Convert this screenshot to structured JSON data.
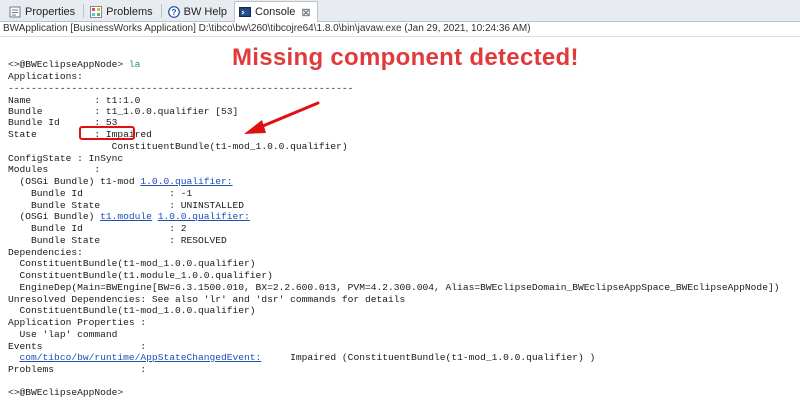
{
  "tabs": [
    {
      "label": "Properties",
      "icon": "properties-icon",
      "active": false
    },
    {
      "label": "Problems",
      "icon": "problems-icon",
      "active": false
    },
    {
      "label": "BW Help",
      "icon": "help-icon",
      "active": false
    },
    {
      "label": "Console",
      "icon": "console-icon",
      "active": true,
      "close": "⊠"
    }
  ],
  "launch_title": "BWApplication [BusinessWorks Application] D:\\tibco\\bw\\260\\tibcojre64\\1.8.0\\bin\\javaw.exe (Jan 29, 2021, 10:24:36 AM)",
  "annotation": {
    "text": "Missing component detected!",
    "color": "#e03a3a"
  },
  "console": {
    "prompt1": "<>@BWEclipseAppNode>",
    "command": "la",
    "applications": "Applications:",
    "separator": "------------------------------------------------------------",
    "name": "Name           : t1:1.0",
    "bundle": "Bundle         : t1_1.0.0.qualifier [53]",
    "bundle_id": "Bundle Id      : 53",
    "state_label": "State          : ",
    "state_value": "Impaired",
    "constituent": "                  ConstituentBundle(t1-mod_1.0.0.qualifier)",
    "configstate": "ConfigState : InSync",
    "modules": "Modules        :",
    "osgi1_prefix": "  (OSGi Bundle) t1-mod ",
    "osgi1_link": "1.0.0.qualifier:",
    "osgi1_bid_label": "    Bundle Id               ",
    "osgi1_bid_value": ": -1",
    "osgi1_bstate": "    Bundle State            : UNINSTALLED",
    "osgi2_prefix": "  (OSGi Bundle) ",
    "osgi2_link1": "t1.module",
    "osgi2_space": " ",
    "osgi2_link2": "1.0.0.qualifier:",
    "osgi2_bid": "    Bundle Id               : 2",
    "osgi2_bstate": "    Bundle State            : RESOLVED",
    "dependencies": "Dependencies:",
    "dep1": "  ConstituentBundle(t1-mod_1.0.0.qualifier)",
    "dep2": "  ConstituentBundle(t1.module_1.0.0.qualifier)",
    "dep3": "  EngineDep(Main=BWEngine[BW=6.3.1500.010, BX=2.2.600.013, PVM=4.2.300.004, Alias=BWEclipseDomain_BWEclipseAppSpace_BWEclipseAppNode])",
    "unresolved": "Unresolved Dependencies: See also 'lr' and 'dsr' commands for details",
    "unres1": "  ConstituentBundle(t1-mod_1.0.0.qualifier)",
    "app_props": "Application Properties :",
    "use_lap": "  Use 'lap' command",
    "events": "Events                 :",
    "event_link": "com/tibco/bw/runtime/AppStateChangedEvent:",
    "event_rest": "     Impaired (ConstituentBundle(t1-mod_1.0.0.qualifier) )",
    "problems": "Problems               :",
    "prompt2": "<>@BWEclipseAppNode>"
  }
}
